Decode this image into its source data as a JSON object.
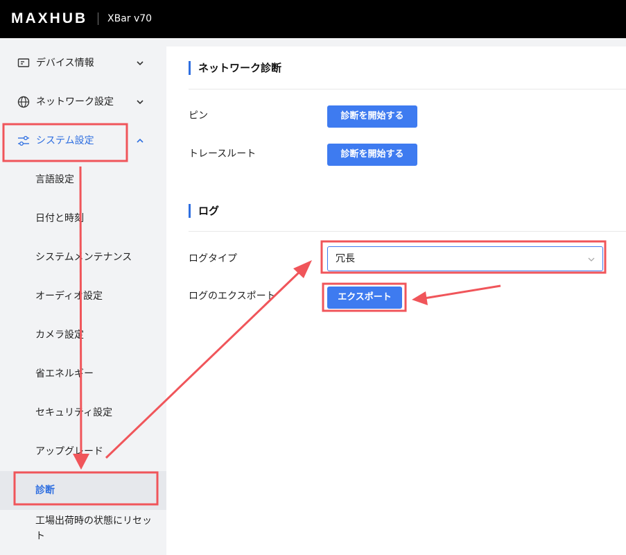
{
  "header": {
    "logo": "MAXHUB",
    "model": "XBar v70"
  },
  "sidebar": {
    "groups": [
      {
        "label": "デバイス情報",
        "icon": "device-info-icon",
        "expanded": false
      },
      {
        "label": "ネットワーク設定",
        "icon": "globe-icon",
        "expanded": false
      },
      {
        "label": "システム設定",
        "icon": "sliders-icon",
        "expanded": true
      }
    ],
    "items": [
      {
        "label": "言語設定"
      },
      {
        "label": "日付と時刻"
      },
      {
        "label": "システムメンテナンス"
      },
      {
        "label": "オーディオ設定"
      },
      {
        "label": "カメラ設定"
      },
      {
        "label": "省エネルギー"
      },
      {
        "label": "セキュリティ設定"
      },
      {
        "label": "アップグレード"
      },
      {
        "label": "診断",
        "selected": true
      },
      {
        "label": "工場出荷時の状態にリセット"
      }
    ]
  },
  "main": {
    "network_section": {
      "title": "ネットワーク診断",
      "ping_label": "ピン",
      "ping_button": "診断を開始する",
      "traceroute_label": "トレースルート",
      "traceroute_button": "診断を開始する"
    },
    "log_section": {
      "title": "ログ",
      "log_type_label": "ログタイプ",
      "log_type_value": "冗長",
      "export_label": "ログのエクスポート",
      "export_button": "エクスポート"
    }
  },
  "colors": {
    "accent": "#3e7bf0",
    "annotation": "#f0555a",
    "topbar": "#000000"
  }
}
